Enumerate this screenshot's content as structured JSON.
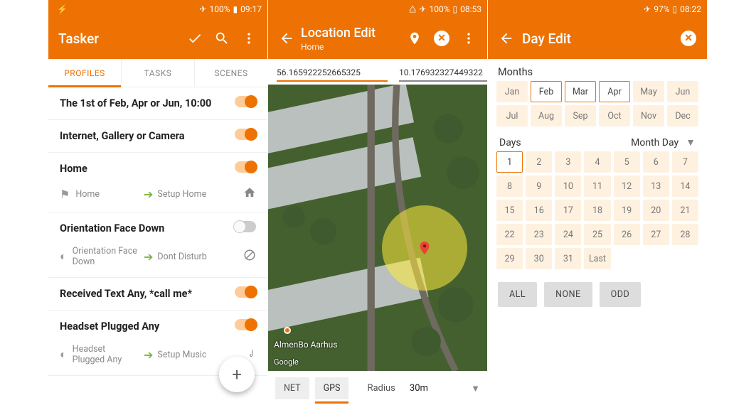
{
  "screen1": {
    "status": {
      "battery": "100%",
      "time": "09:17"
    },
    "title": "Tasker",
    "tabs": [
      "PROFILES",
      "TASKS",
      "SCENES"
    ],
    "active_tab": 0,
    "profiles": [
      {
        "title": "The 1st of Feb, Apr or Jun, 10:00",
        "on": true
      },
      {
        "title": "Internet, Gallery or Camera",
        "on": true
      },
      {
        "title": "Home",
        "on": true,
        "context_label": "Home",
        "task_label": "Setup Home"
      },
      {
        "title": "Orientation Face Down",
        "on": false,
        "context_label": "Orientation Face Down",
        "task_label": "Dont Disturb"
      },
      {
        "title": "Received Text Any, *call me*",
        "on": true
      },
      {
        "title": "Headset Plugged Any",
        "on": true,
        "context_label": "Headset Plugged Any",
        "task_label": "Setup Music"
      }
    ]
  },
  "screen2": {
    "status": {
      "battery": "100%",
      "time": "08:53"
    },
    "title": "Location Edit",
    "subtitle": "Home",
    "lat": "56.165922252665325",
    "lon": "10.176932327449322",
    "map_poi": "AlmenBo Aarhus",
    "map_attrib": "Google",
    "net_btn": "NET",
    "gps_btn": "GPS",
    "radius_label": "Radius",
    "radius_value": "30m"
  },
  "screen3": {
    "status": {
      "battery": "97%",
      "time": "08:22"
    },
    "title": "Day Edit",
    "months_label": "Months",
    "months": [
      "Jan",
      "Feb",
      "Mar",
      "Apr",
      "May",
      "Jun",
      "Jul",
      "Aug",
      "Sep",
      "Oct",
      "Nov",
      "Dec"
    ],
    "months_selected": [
      1,
      2,
      3
    ],
    "days_label": "Days",
    "day_mode": "Month Day",
    "days_last": "Last",
    "days_selected": [
      1
    ],
    "btn_all": "ALL",
    "btn_none": "NONE",
    "btn_odd": "ODD"
  }
}
